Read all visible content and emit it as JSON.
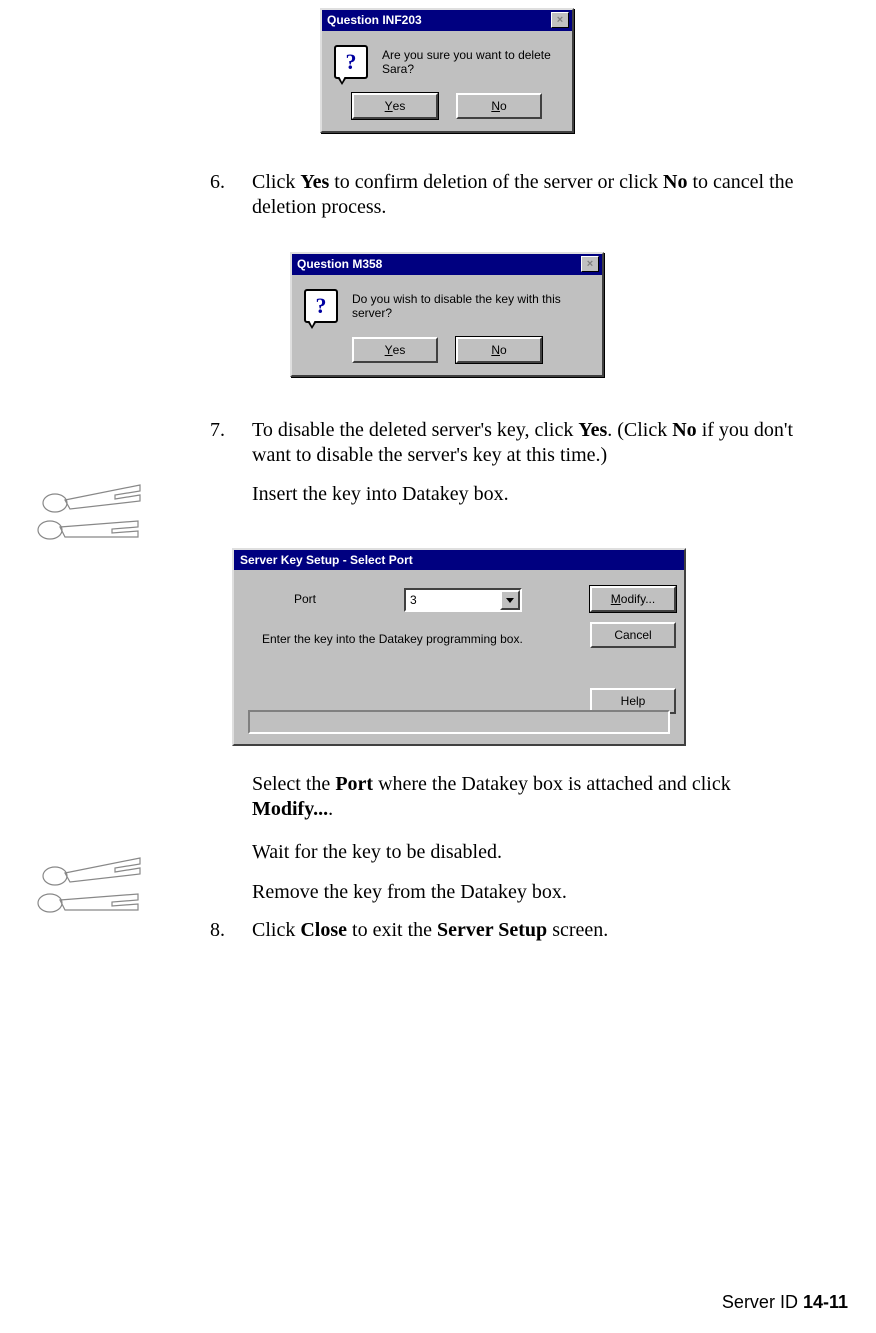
{
  "dialog1": {
    "title": "Question INF203",
    "message": "Are you sure you want to delete Sara?",
    "yes": "Yes",
    "no": "No",
    "close_glyph": "×"
  },
  "step6": {
    "num": "6.",
    "text_before_yes": "Click ",
    "yes": "Yes",
    "text_mid": " to confirm deletion of the server or click ",
    "no": "No",
    "text_after": " to cancel the deletion process."
  },
  "dialog2": {
    "title": "Question M358",
    "message": "Do you wish to disable the key with this server?",
    "yes": "Yes",
    "no": "No",
    "close_glyph": "×"
  },
  "step7": {
    "num": "7.",
    "t1": "To disable the deleted server's key, click ",
    "yes": "Yes",
    "t2": ". (Click ",
    "no": "No",
    "t3": " if you don't want to disable the server's key at this time.)",
    "insert": "Insert the key into Datakey box."
  },
  "setup": {
    "title": "Server Key Setup - Select Port",
    "port_label": "Port",
    "port_value": "3",
    "hint": "Enter the key into the Datakey programming box.",
    "modify": "Modify...",
    "cancel": "Cancel",
    "help": "Help"
  },
  "post_setup": {
    "p1a": "Select the ",
    "port": "Port",
    "p1b": " where the Datakey box is attached and click ",
    "modify": "Modify...",
    "p1c": ".",
    "p2": "Wait for the key to be disabled.",
    "p3": "Remove the key from the Datakey box."
  },
  "step8": {
    "num": "8.",
    "t1": "Click ",
    "close": "Close",
    "t2": " to exit the ",
    "screen": "Server Setup",
    "t3": " screen."
  },
  "footer": {
    "section": "Server ID  ",
    "page": "14-11"
  }
}
